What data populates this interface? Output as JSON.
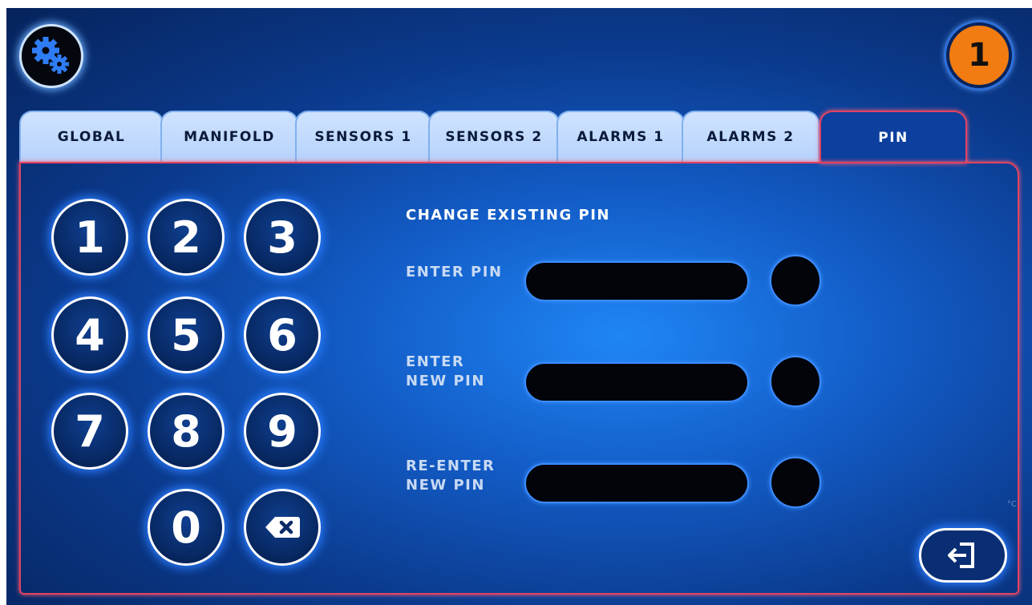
{
  "header": {
    "settings_icon": "gears-icon",
    "notification_count": "1",
    "badge_color": "#f27c11"
  },
  "tabs": [
    {
      "label": "GLOBAL",
      "active": false
    },
    {
      "label": "MANIFOLD",
      "active": false
    },
    {
      "label": "SENSORS 1",
      "active": false
    },
    {
      "label": "SENSORS 2",
      "active": false
    },
    {
      "label": "ALARMS 1",
      "active": false
    },
    {
      "label": "ALARMS 2",
      "active": false
    },
    {
      "label": "PIN",
      "active": true
    }
  ],
  "keypad": {
    "keys": [
      "1",
      "2",
      "3",
      "4",
      "5",
      "6",
      "7",
      "8",
      "9",
      "0"
    ],
    "backspace_icon": "backspace-icon"
  },
  "pin_form": {
    "title": "CHANGE EXISTING PIN",
    "fields": [
      {
        "label_line1": "ENTER PIN",
        "label_line2": "",
        "value": ""
      },
      {
        "label_line1": "ENTER",
        "label_line2": "NEW PIN",
        "value": ""
      },
      {
        "label_line1": "RE-ENTER",
        "label_line2": "NEW PIN",
        "value": ""
      }
    ]
  },
  "footer": {
    "unit": "°C",
    "exit_icon": "exit-icon"
  },
  "colors": {
    "accent": "#3b8cff",
    "active_tab_border": "#e0435f",
    "background": "#0b3a8d"
  }
}
